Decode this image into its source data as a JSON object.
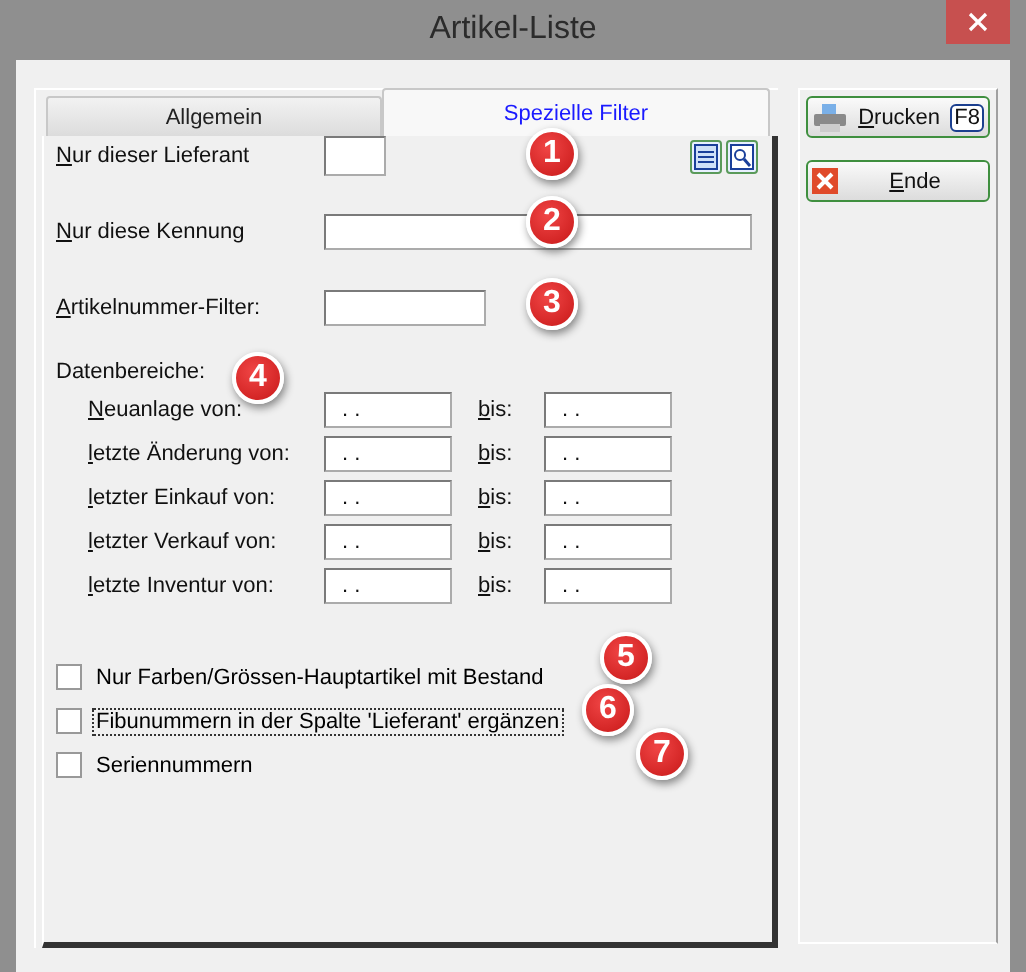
{
  "window": {
    "title": "Artikel-Liste"
  },
  "tabs": [
    {
      "label": "Allgemein",
      "selected": false
    },
    {
      "label": "Spezielle Filter",
      "selected": true
    }
  ],
  "fields": [
    {
      "label": "Nur dieser Lieferant",
      "mnemonic": true,
      "kind": "short"
    },
    {
      "label": "Nur diese Kennung",
      "mnemonic": true,
      "kind": "wide"
    },
    {
      "label": "Artikelnummer-Filter:",
      "mnemonic": true,
      "kind": "medium"
    }
  ],
  "date_ranges": {
    "heading": "Datenbereiche:",
    "rows": [
      {
        "label": "Neuanlage von:",
        "mnemonic": true,
        "from": ". .",
        "to_label": "bis:",
        "to_mnemonic": true,
        "to": ". ."
      },
      {
        "label": "letzte Änderung von:",
        "mnemonic": true,
        "from": ". .",
        "to_label": "bis:",
        "to_mnemonic": true,
        "to": ". ."
      },
      {
        "label": "letzter Einkauf von:",
        "mnemonic": true,
        "from": ". .",
        "to_label": "bis:",
        "to_mnemonic": true,
        "to": ". ."
      },
      {
        "label": "letzter Verkauf von:",
        "mnemonic": true,
        "from": ". .",
        "to_label": "bis:",
        "to_mnemonic": true,
        "to": ". ."
      },
      {
        "label": "letzte Inventur von:",
        "mnemonic": true,
        "from": ". .",
        "to_label": "bis:",
        "to_mnemonic": true,
        "to": ". ."
      }
    ]
  },
  "checkboxes": [
    {
      "label": "Nur Farben/Grössen-Hauptartikel mit Bestand",
      "checked": false,
      "focused": false
    },
    {
      "label": "Fibunummern in der Spalte 'Lieferant' ergänzen",
      "checked": false,
      "focused": true
    },
    {
      "label": "Seriennummern",
      "checked": false,
      "focused": false
    }
  ],
  "buttons": [
    {
      "label": "Drucken",
      "shortcut": "F8",
      "kind": "print"
    },
    {
      "label": "Ende",
      "kind": "exit"
    }
  ],
  "markers": [
    "1",
    "2",
    "3",
    "4",
    "5",
    "6",
    "7"
  ]
}
